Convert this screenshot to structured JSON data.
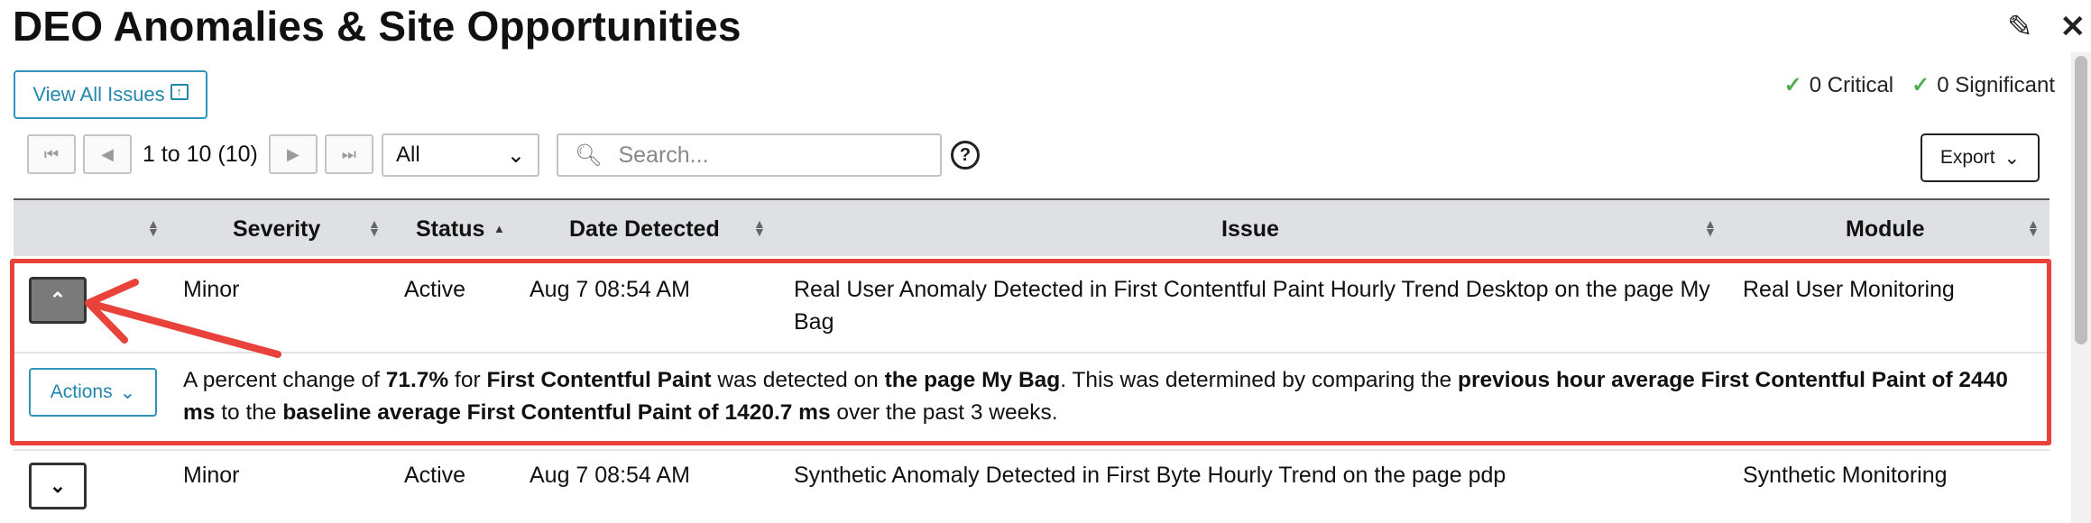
{
  "page": {
    "title": "DEO Anomalies & Site Opportunities",
    "edit_icon": "pencil-icon",
    "close_icon": "close-icon"
  },
  "toolbar": {
    "view_all_label": "View All Issues",
    "critical_label": "0 Critical",
    "significant_label": "0 Significant"
  },
  "pager": {
    "range_text": "1 to 10 (10)",
    "filter_value": "All",
    "search_placeholder": "Search...",
    "export_label": "Export"
  },
  "table": {
    "columns": [
      "Severity",
      "Status",
      "Date Detected",
      "Issue",
      "Module"
    ],
    "rows": [
      {
        "severity": "Minor",
        "status": "Active",
        "date": "Aug 7 08:54 AM",
        "issue_line1": "Real User Anomaly Detected in First Contentful Paint Hourly Trend Desktop on the page My",
        "issue_line2": "Bag",
        "module": "Real User Monitoring",
        "expanded": true
      },
      {
        "severity": "Minor",
        "status": "Active",
        "date": "Aug 7 08:54 AM",
        "issue_line1": "Synthetic Anomaly Detected in First Byte Hourly Trend on the page pdp",
        "module": "Synthetic Monitoring",
        "expanded": false
      }
    ],
    "detail": {
      "actions_label": "Actions",
      "t1": "A percent change of ",
      "b1": "71.7%",
      "t2": " for ",
      "b2": "First Contentful Paint",
      "t3": " was detected on ",
      "b3": "the page My Bag",
      "t4": ". This was determined by comparing the ",
      "b4": "previous hour average First Contentful Paint of 2440 ms",
      "t5": " to the ",
      "b5": "baseline average First Contentful Paint of 1420.7 ms",
      "t6": " over the past 3 weeks."
    }
  },
  "colors": {
    "accent": "#2287ad",
    "highlight": "#e8423a",
    "check": "#4caf50"
  }
}
